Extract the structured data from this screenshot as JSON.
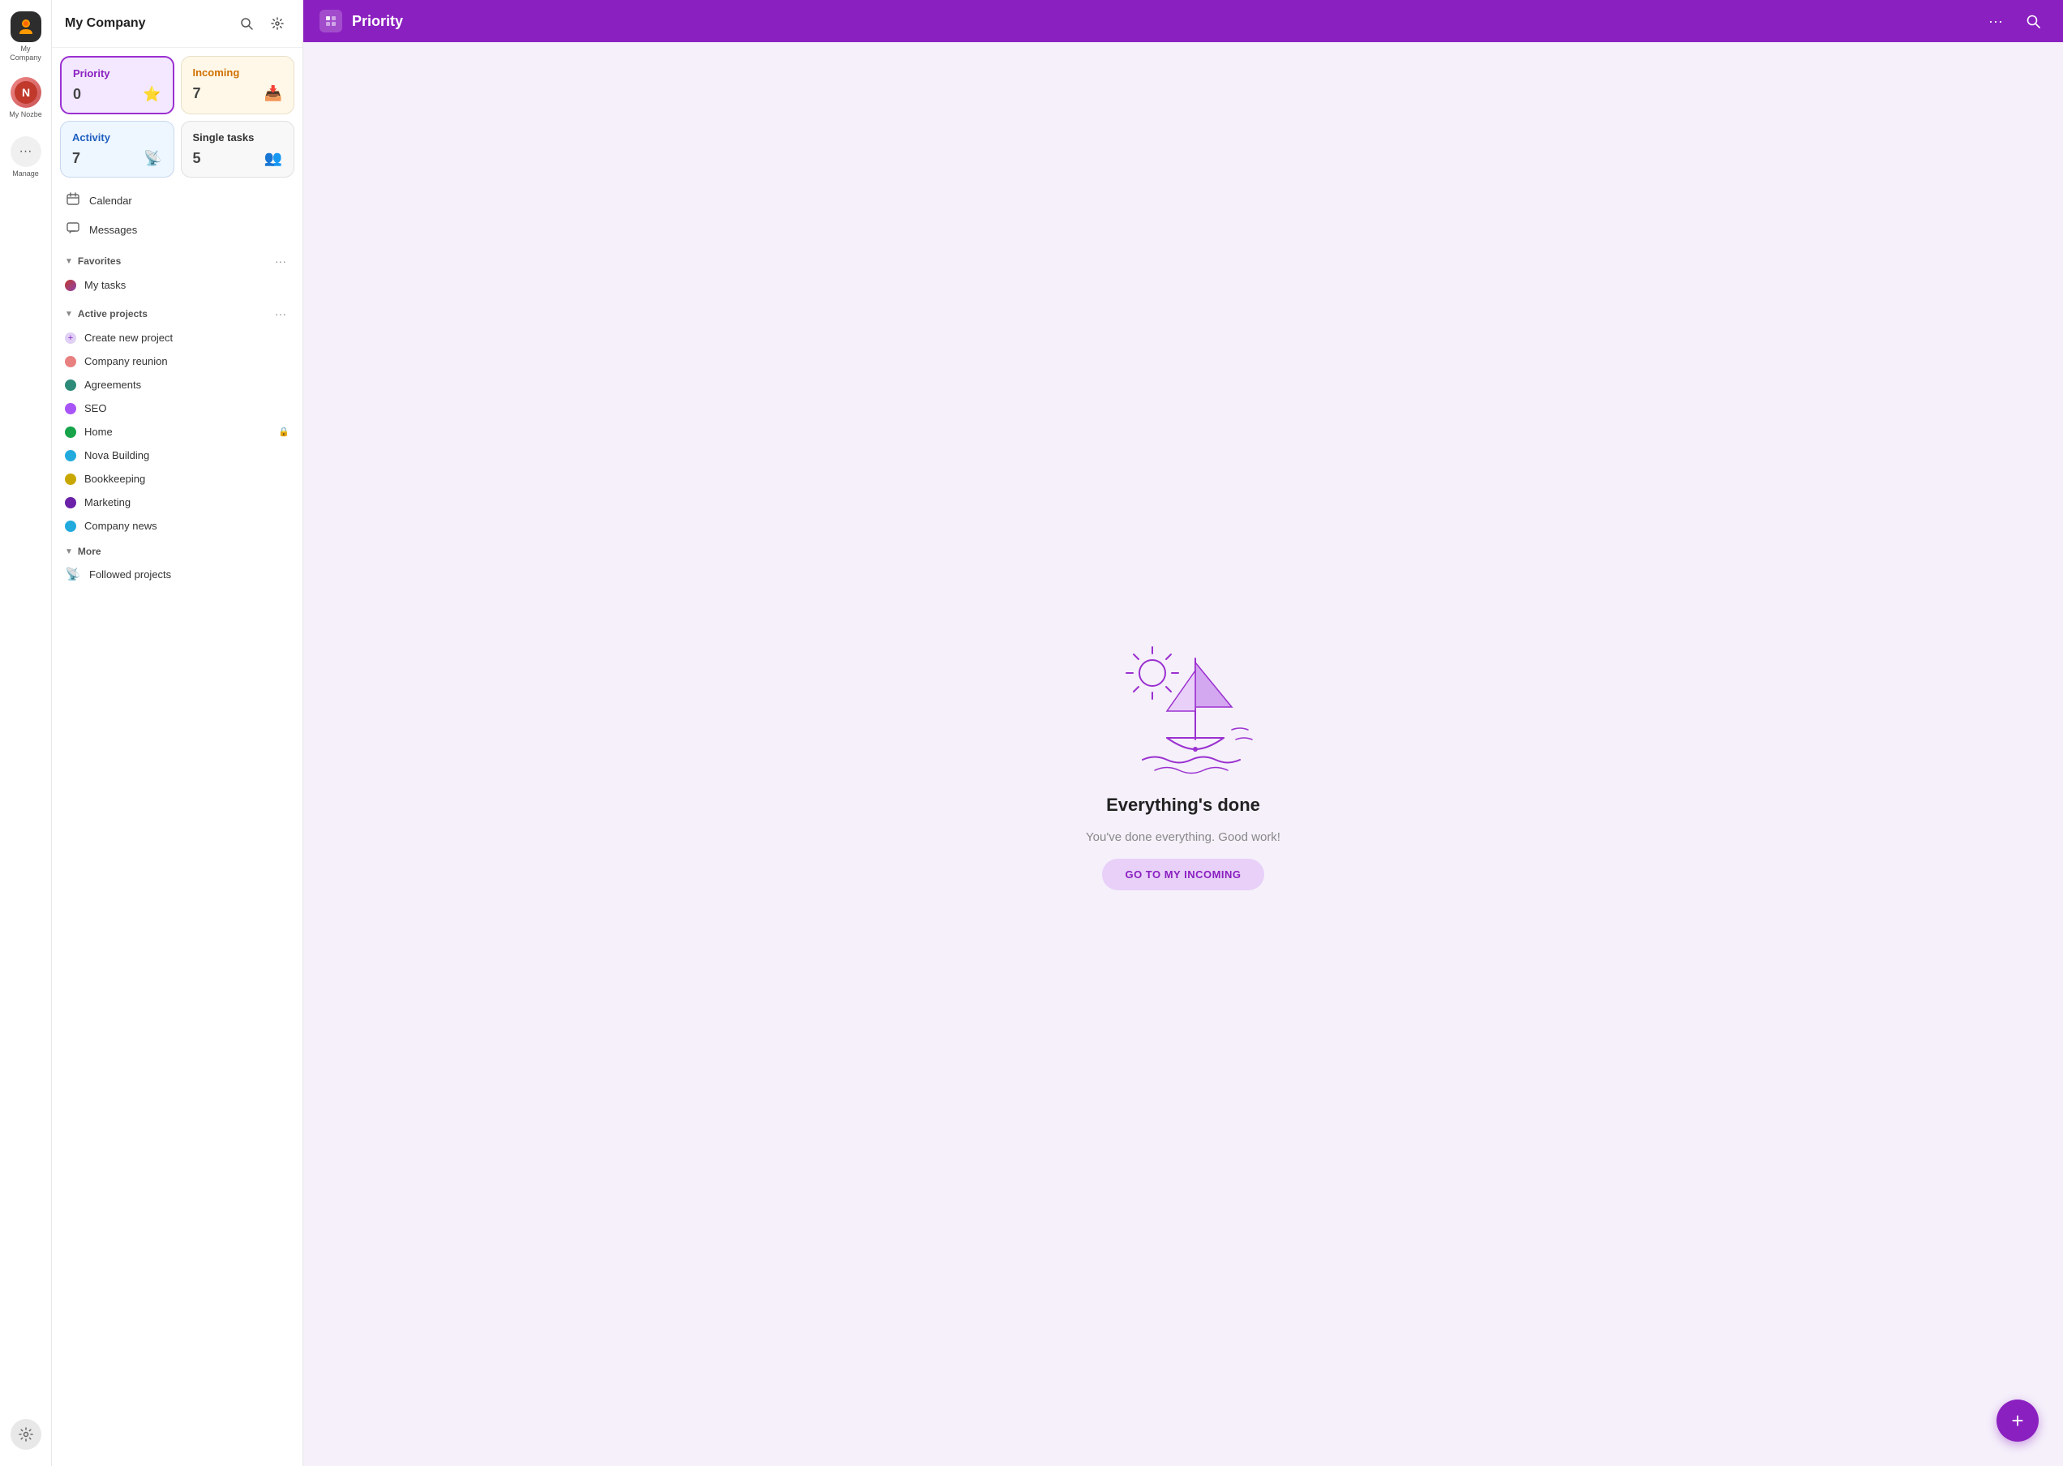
{
  "app": {
    "company_name": "My Company",
    "rail": {
      "company_label": "My Company",
      "nozbe_label": "My Nozbe",
      "manage_label": "Manage"
    }
  },
  "sidebar": {
    "title": "My Company",
    "search_tooltip": "Search",
    "settings_tooltip": "Settings",
    "cards": [
      {
        "id": "priority",
        "label": "Priority",
        "count": "0",
        "icon": "⭐"
      },
      {
        "id": "incoming",
        "label": "Incoming",
        "count": "7",
        "icon": "📥"
      },
      {
        "id": "activity",
        "label": "Activity",
        "count": "7",
        "icon": "📡"
      },
      {
        "id": "single",
        "label": "Single tasks",
        "count": "5",
        "icon": "👥"
      }
    ],
    "nav_items": [
      {
        "id": "calendar",
        "label": "Calendar",
        "icon": "📅"
      },
      {
        "id": "messages",
        "label": "Messages",
        "icon": "💬"
      }
    ],
    "favorites": {
      "label": "Favorites",
      "items": [
        {
          "id": "my-tasks",
          "label": "My tasks",
          "avatar": "🟤"
        }
      ]
    },
    "active_projects": {
      "label": "Active projects",
      "items": [
        {
          "id": "create",
          "label": "Create new project",
          "color": "none",
          "is_create": true
        },
        {
          "id": "company-reunion",
          "label": "Company reunion",
          "color": "#e88080"
        },
        {
          "id": "agreements",
          "label": "Agreements",
          "color": "#2e8b7a"
        },
        {
          "id": "seo",
          "label": "SEO",
          "color": "#a855f7"
        },
        {
          "id": "home",
          "label": "Home",
          "color": "#16a34a",
          "locked": true
        },
        {
          "id": "nova-building",
          "label": "Nova Building",
          "color": "#22aadd"
        },
        {
          "id": "bookkeeping",
          "label": "Bookkeeping",
          "color": "#c8a800"
        },
        {
          "id": "marketing",
          "label": "Marketing",
          "color": "#6b21a8"
        },
        {
          "id": "company-news",
          "label": "Company news",
          "color": "#22aadd"
        }
      ]
    },
    "more": {
      "label": "More",
      "items": [
        {
          "id": "followed-projects",
          "label": "Followed projects",
          "icon": "📡"
        }
      ]
    }
  },
  "main": {
    "header": {
      "title": "Priority",
      "menu_icon": "···"
    },
    "empty_state": {
      "title": "Everything's done",
      "subtitle": "You've done everything. Good work!",
      "button_label": "GO TO MY INCOMING"
    }
  }
}
